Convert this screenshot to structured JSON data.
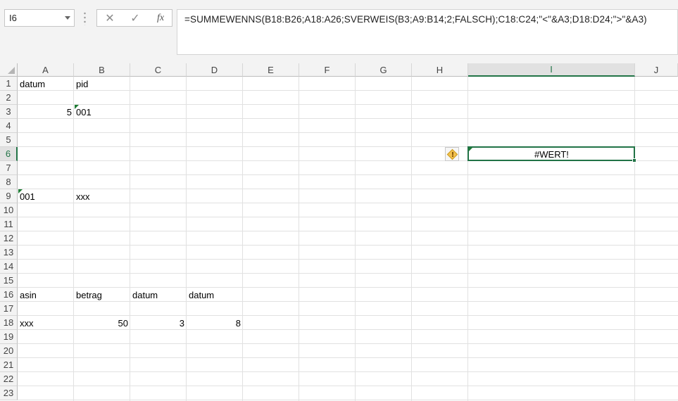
{
  "name_box": {
    "value": "I6"
  },
  "formula_bar": {
    "cancel_icon": "close-icon",
    "enter_icon": "check-icon",
    "fx_label": "fx",
    "formula": "=SUMMEWENNS(B18:B26;A18:A26;SVERWEIS(B3;A9:B14;2;FALSCH);C18:C24;\"<\"&A3;D18:D24;\">\"&A3)"
  },
  "columns": [
    "A",
    "B",
    "C",
    "D",
    "E",
    "F",
    "G",
    "H",
    "I",
    "J"
  ],
  "rows": [
    "1",
    "2",
    "3",
    "4",
    "5",
    "6",
    "7",
    "8",
    "9",
    "10",
    "11",
    "12",
    "13",
    "14",
    "15",
    "16",
    "17",
    "18",
    "19",
    "20",
    "21",
    "22",
    "23"
  ],
  "active_cell": {
    "column": "I",
    "row": "6"
  },
  "cells": {
    "A1": "datum",
    "B1": "pid",
    "A3": "5",
    "B3": "001",
    "I6": "#WERT!",
    "A9": "001",
    "B9": "xxx",
    "A16": "asin",
    "B16": "betrag",
    "C16": "datum",
    "D16": "datum",
    "A18": "xxx",
    "B18": "50",
    "C18": "3",
    "D18": "8"
  },
  "colors": {
    "accent": "#217346",
    "error_indicator": "#f2c14e",
    "text_marker": "#1e7b34"
  }
}
